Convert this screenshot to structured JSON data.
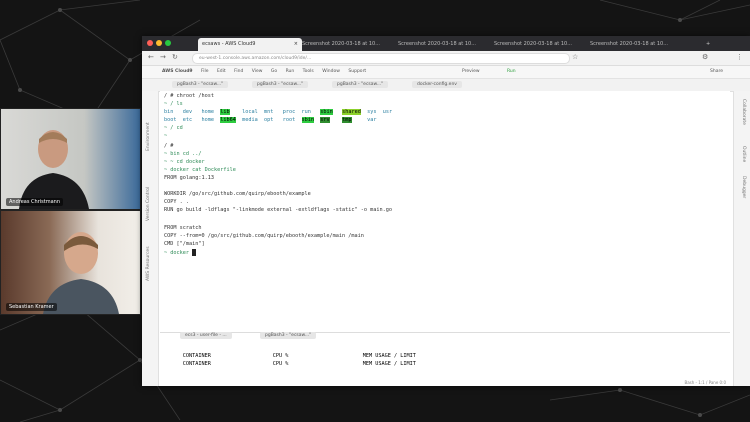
{
  "browser": {
    "tabs": [
      {
        "label": "ecsaws - AWS Cloud9",
        "active": true
      },
      {
        "label": "Screenshot 2020-03-18 at 10...",
        "active": false
      },
      {
        "label": "Screenshot 2020-03-18 at 10...",
        "active": false
      },
      {
        "label": "Screenshot 2020-03-18 at 10...",
        "active": false
      },
      {
        "label": "Screenshot 2020-03-18 at 10...",
        "active": false
      }
    ],
    "url": "eu-west-1.console.aws.amazon.com/cloud9/ide/..."
  },
  "cloud9": {
    "logo": "AWS Cloud9",
    "menu": [
      "File",
      "Edit",
      "Find",
      "View",
      "Go",
      "Run",
      "Tools",
      "Window",
      "Support"
    ],
    "preview": "Preview",
    "run": "Run",
    "share": "Share",
    "tabs": [
      "pgBash3 - \"ecsaw...\"",
      "pgBash3 - \"ecsaw...\"",
      "pgBash3 - \"ecsaw...\"",
      "docker-config.env"
    ],
    "left_sidebar": [
      "Environment",
      "Version Control",
      "AWS Resources"
    ],
    "right_sidebar": [
      "Collaborate",
      "Outline",
      "Debugger"
    ],
    "bottom_tabs": [
      "ecs3 - user-file - ...",
      "pgBash3 - \"ecsaw...\""
    ],
    "status": "Bash - 1:1 / Pane 0:0"
  },
  "terminal": {
    "lines": [
      "/ # chroot /host",
      "~ / ls",
      "bin   dev   home  lib    local  mnt   proc  run   sbin   shared  sys  usr",
      "boot  etc   home  lib64  media  opt   root  sbin  srv    tmp     var",
      "~ / cd",
      "~",
      "/ #",
      "~ bin cd ../",
      "~ ~ cd docker",
      "~ docker cat Dockerfile",
      "FROM golang:1.13",
      "",
      "WORKDIR /go/src/github.com/quirp/ebooth/example",
      "COPY . .",
      "RUN go build -ldflags \"-linkmode external -extldflags -static\" -o main.go",
      "",
      "FROM scratch",
      "COPY --from=0 /go/src/github.com/quirp/ebooth/example/main /main",
      "CMD [\"/main\"]",
      "~ docker "
    ],
    "stats_header": [
      "CONTAINER",
      "CPU %",
      "MEM USAGE / LIMIT"
    ],
    "stats_rows": [
      [
        "CONTAINER",
        "CPU %",
        "MEM USAGE / LIMIT"
      ],
      [
        "CONTAINER",
        "CPU %",
        "MEM USAGE / LIMIT"
      ]
    ]
  },
  "participants": [
    {
      "name": "Andreas Christmann"
    },
    {
      "name": "Sebastian Kramer"
    }
  ]
}
